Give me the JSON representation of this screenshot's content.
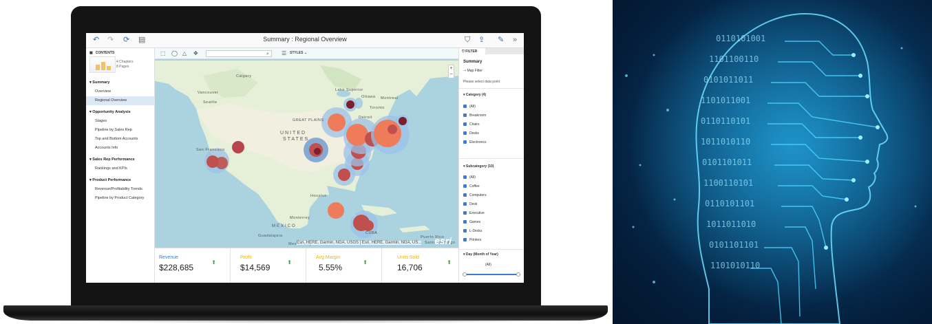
{
  "app": {
    "title": "Summary : Regional Overview",
    "toolbar_icons": [
      "undo-icon",
      "redo-icon",
      "refresh-icon",
      "notes-icon"
    ],
    "right_icons": [
      "filter-icon",
      "share-icon",
      "edit-icon",
      "chevrons-icon"
    ]
  },
  "sidebar": {
    "header": "CONTENTS",
    "chapters": "4 Chapters",
    "pages": "8 Pages",
    "sections": [
      {
        "label": "Summary",
        "items": [
          "Overview",
          "Regional Overview"
        ]
      },
      {
        "label": "Opportunity Analysis",
        "items": [
          "Stages",
          "Pipeline by Sales Rep",
          "Top and Bottom Accounts",
          "Accounts Info"
        ]
      },
      {
        "label": "Sales Rep Performance",
        "items": [
          "Rankings and KPIs"
        ]
      },
      {
        "label": "Product Performance",
        "items": [
          "Revenue/Profitability Trends",
          "Pipeline by Product Category"
        ]
      }
    ],
    "active_item": "Regional Overview"
  },
  "map": {
    "styles_label": "STYLES",
    "attribution": "Esri, HERE, Garmin, NGA, USGS | Esri, HERE, Garmin, NGA, US...",
    "logo": "esri",
    "labels": [
      "Calgary",
      "Vancouver",
      "Seattle",
      "San Francisco",
      "UNITED",
      "STATES",
      "GREAT PLAINS",
      "Ottawa",
      "Montreal",
      "Toronto",
      "Detroit",
      "Houston",
      "Monterrey",
      "MEXICO",
      "Guadalajara",
      "Mexico City",
      "CUBA",
      "Puerto Rico",
      "Santo Domingo",
      "Lake Superior"
    ]
  },
  "kpis": [
    {
      "label": "Revenue",
      "value": "$228,685",
      "color": "#3a7bd5"
    },
    {
      "label": "Profit",
      "value": "$14,569",
      "color": "#f0b400"
    },
    {
      "label": "Avg Margin",
      "value": "5.55%",
      "color": "#f0b400"
    },
    {
      "label": "Units Sold",
      "value": "16,706",
      "color": "#f0b400"
    }
  ],
  "filter": {
    "header": "FILTER",
    "title": "Summary",
    "map_filter": "Map Filter",
    "map_filter_hint": "Please select data point",
    "category_title": "Category (4)",
    "category_items": [
      "(All)",
      "Breakroom",
      "Chairs",
      "Desks",
      "Electronics"
    ],
    "subcategory_title": "Subcategory (10)",
    "subcategory_items": [
      "(All)",
      "Coffee",
      "Computers",
      "Desk",
      "Executive",
      "Games",
      "L-Desks",
      "Printers"
    ],
    "day_title": "Day (Month of Year)",
    "day_value": "(All)"
  },
  "ai_panel": {
    "binary_rows": [
      "0110101001",
      "1101100110",
      "0101011011",
      "1101011001",
      "0110110101",
      "1011010110",
      "0101101011",
      "1100110101",
      "0110101101",
      "1011011010",
      "0101101101",
      "1101010110"
    ]
  }
}
